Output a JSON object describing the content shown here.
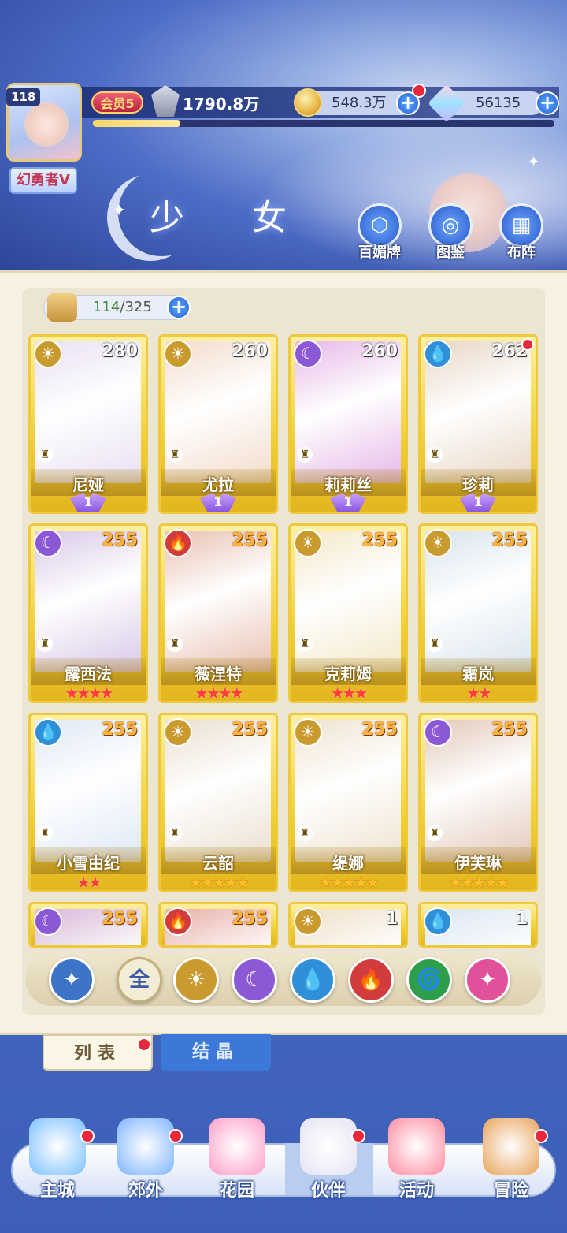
{
  "player": {
    "level": "118",
    "name": "幻勇者V",
    "vip": "会员5",
    "power": "1790.8万",
    "exp_fraction": 0.19
  },
  "resources": {
    "gold": "548.3万",
    "gems": "56135"
  },
  "page_title": "少 女",
  "menu": [
    {
      "label": "百媚牌",
      "icon": "card-book-icon"
    },
    {
      "label": "图鉴",
      "icon": "codex-book-icon"
    },
    {
      "label": "布阵",
      "icon": "formation-grid-icon"
    }
  ],
  "collection": {
    "current": "114",
    "max": "325"
  },
  "elements": {
    "sun": {
      "color": "#c99a2e",
      "glyph": "☀"
    },
    "moon": {
      "color": "#8b58d6",
      "glyph": "☾"
    },
    "water": {
      "color": "#2f8fd8",
      "glyph": "💧"
    },
    "fire": {
      "color": "#d23b3b",
      "glyph": "🔥"
    },
    "wind": {
      "color": "#2f9e4a",
      "glyph": "🌀"
    },
    "star": {
      "color": "#e0519a",
      "glyph": "✦"
    }
  },
  "cards": [
    {
      "name": "尼娅",
      "level": "280",
      "element": "sun",
      "wing": "1",
      "stars": 0,
      "color": "#e8e0f4",
      "dot": false
    },
    {
      "name": "尤拉",
      "level": "260",
      "element": "sun",
      "wing": "1",
      "stars": 0,
      "color": "#f3dccb",
      "dot": false
    },
    {
      "name": "莉莉丝",
      "level": "260",
      "element": "moon",
      "wing": "1",
      "stars": 0,
      "color": "#e6b8e8",
      "dot": false
    },
    {
      "name": "珍莉",
      "level": "262",
      "element": "water",
      "wing": "1",
      "stars": 0,
      "color": "#e8d6c4",
      "dot": true
    },
    {
      "name": "露西法",
      "level": "255",
      "element": "moon",
      "wing": "",
      "stars": 4,
      "star_style": "red",
      "color": "#d8c8e8",
      "dot": false
    },
    {
      "name": "薇涅特",
      "level": "255",
      "element": "fire",
      "wing": "",
      "stars": 4,
      "star_style": "red",
      "color": "#e8c0b0",
      "dot": false
    },
    {
      "name": "克莉姆",
      "level": "255",
      "element": "sun",
      "wing": "",
      "stars": 3,
      "star_style": "red",
      "color": "#f3e8c8",
      "dot": false
    },
    {
      "name": "霜岚",
      "level": "255",
      "element": "sun",
      "wing": "",
      "stars": 2,
      "star_style": "red",
      "color": "#d8e4ee",
      "dot": false
    },
    {
      "name": "小雪由纪",
      "level": "255",
      "element": "water",
      "wing": "",
      "stars": 2,
      "star_style": "red",
      "color": "#dfe8f6",
      "dot": false
    },
    {
      "name": "云韶",
      "level": "255",
      "element": "sun",
      "wing": "",
      "stars": 5,
      "star_style": "gold",
      "color": "#eadfcf",
      "dot": false
    },
    {
      "name": "缇娜",
      "level": "255",
      "element": "sun",
      "wing": "",
      "stars": 5,
      "star_style": "gold",
      "color": "#efe3cf",
      "dot": false
    },
    {
      "name": "伊芙琳",
      "level": "255",
      "element": "moon",
      "wing": "",
      "stars": 5,
      "star_style": "gold",
      "color": "#e2c8b8",
      "dot": false
    },
    {
      "name": "",
      "level": "255",
      "element": "moon",
      "wing": "",
      "stars": 0,
      "color": "#d8b8d8",
      "dot": false
    },
    {
      "name": "",
      "level": "255",
      "element": "fire",
      "wing": "",
      "stars": 0,
      "color": "#e8b0a8",
      "dot": false
    },
    {
      "name": "",
      "level": "1",
      "element": "sun",
      "wing": "",
      "stars": 0,
      "color": "#f0e0c8",
      "dot": false
    },
    {
      "name": "",
      "level": "1",
      "element": "water",
      "wing": "",
      "stars": 0,
      "color": "#dbe6f4",
      "dot": false
    }
  ],
  "filters": [
    {
      "name": "type-toggle",
      "label": "✦",
      "color": "#3d74c8"
    },
    {
      "name": "all",
      "label": "全",
      "color": "#f3ecd6"
    },
    {
      "name": "sun",
      "label": "☀",
      "color": "#c99a2e"
    },
    {
      "name": "moon",
      "label": "☾",
      "color": "#8b58d6"
    },
    {
      "name": "water",
      "label": "💧",
      "color": "#2f8fd8"
    },
    {
      "name": "fire",
      "label": "🔥",
      "color": "#d23b3b"
    },
    {
      "name": "wind",
      "label": "🌀",
      "color": "#2f9e4a"
    },
    {
      "name": "star",
      "label": "✦",
      "color": "#e0519a"
    }
  ],
  "tabs": {
    "list": "列表",
    "crystal": "结晶"
  },
  "nav": [
    {
      "label": "主城",
      "icon": "castle-icon",
      "color": "#7cc0ff",
      "dot": true
    },
    {
      "label": "郊外",
      "icon": "portal-icon",
      "color": "#7db4ff",
      "dot": true
    },
    {
      "label": "花园",
      "icon": "heart-garden-icon",
      "color": "#ff9ec8",
      "dot": false
    },
    {
      "label": "伙伴",
      "icon": "partner-icon",
      "color": "#e6e2f4",
      "dot": true
    },
    {
      "label": "活动",
      "icon": "gift-icon",
      "color": "#ff8ca0",
      "dot": false
    },
    {
      "label": "冒险",
      "icon": "compass-icon",
      "color": "#e8a35a",
      "dot": true
    }
  ]
}
